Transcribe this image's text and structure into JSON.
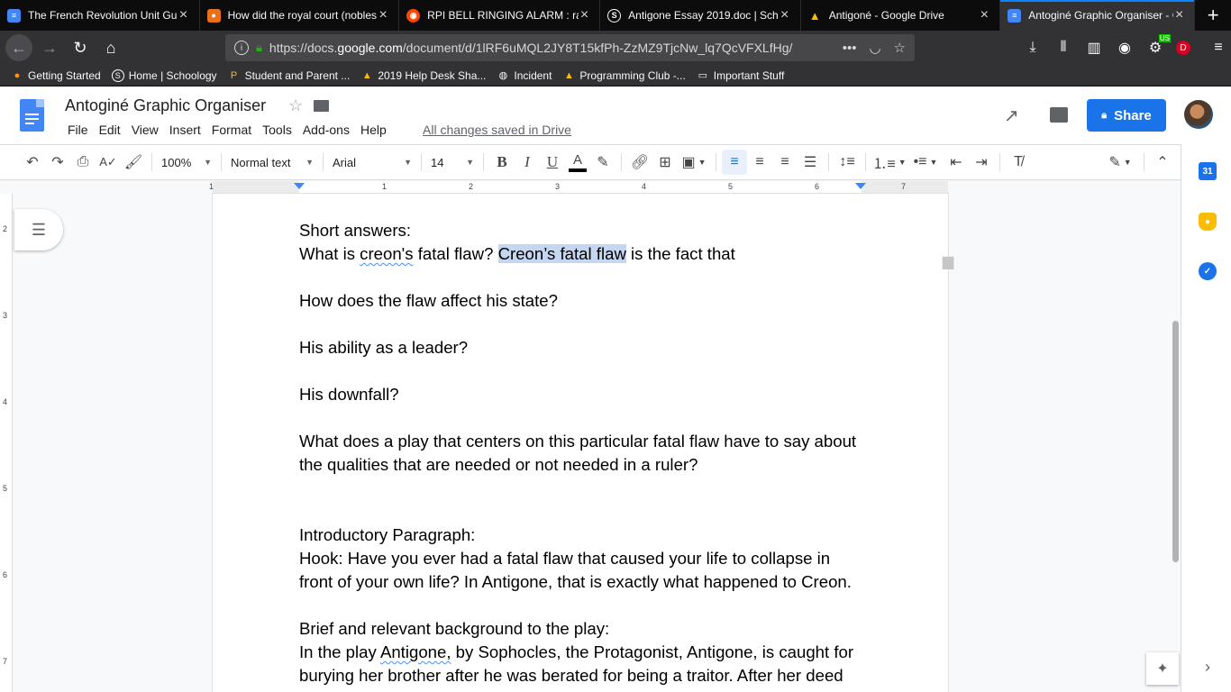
{
  "browser": {
    "tabs": [
      {
        "title": "The French Revolution Unit Gu",
        "color": "#4285f4",
        "glyph": "≡"
      },
      {
        "title": "How did the royal court (nobles",
        "color": "#e8711a",
        "glyph": "●"
      },
      {
        "title": "RPI BELL RINGING ALARM : ras",
        "color": "#ff4500",
        "glyph": "◉"
      },
      {
        "title": "Antigone Essay 2019.doc | Sch",
        "color": "#3b6ea8",
        "glyph": "S"
      },
      {
        "title": "Antigoné - Google Drive",
        "color": "#0f9d58",
        "glyph": "▲"
      },
      {
        "title": "Antoginé Graphic Organiser - G",
        "color": "#4285f4",
        "glyph": "≡"
      }
    ],
    "url_prefix": "https://docs.",
    "url_domain": "google.com",
    "url_rest": "/document/d/1lRF6uMQL2JY8T15kfPh-ZzMZ9TjcNw_lq7QcVFXLfHg/",
    "bookmarks": [
      {
        "label": "Getting Started",
        "icon": "firefox-icon"
      },
      {
        "label": "Home | Schoology",
        "icon": "schoology-icon"
      },
      {
        "label": "Student and Parent ...",
        "icon": "parent-portal-icon"
      },
      {
        "label": "2019 Help Desk Sha...",
        "icon": "drive-icon"
      },
      {
        "label": "Incident",
        "icon": "globe-icon"
      },
      {
        "label": "Programming Club -...",
        "icon": "drive-icon"
      },
      {
        "label": "Important Stuff",
        "icon": "folder-icon"
      }
    ],
    "badge_us": "US",
    "avatar_letter": "D"
  },
  "doc": {
    "title": "Antoginé Graphic Organiser",
    "menu": [
      "File",
      "Edit",
      "View",
      "Insert",
      "Format",
      "Tools",
      "Add-ons",
      "Help"
    ],
    "saved_status": "All changes saved in Drive",
    "share_label": "Share"
  },
  "toolbar": {
    "zoom": "100%",
    "style": "Normal text",
    "font": "Arial",
    "size": "14"
  },
  "rulers": {
    "horizontal": [
      "1",
      "1",
      "2",
      "3",
      "4",
      "5",
      "6",
      "7"
    ],
    "vertical": [
      "2",
      "3",
      "4",
      "5",
      "6",
      "7"
    ]
  },
  "content": {
    "short_answers": "Short answers:",
    "q1_a": "What is ",
    "q1_b": "creon's",
    "q1_c": " fatal flaw? ",
    "q1_sel": "Creon’s fatal flaw",
    "q1_d": " is the fact that",
    "q2": "How does the flaw affect his state?",
    "q3": "His ability as a leader?",
    "q4": "His downfall?",
    "q5": "What does a play that centers on this particular fatal flaw have to say about the qualities that are needed or not needed in a ruler?",
    "intro": "Introductory Paragraph:",
    "hook": "Hook: Have you ever had a fatal flaw that caused your life to collapse in front of your own life? In Antigone, that is exactly what happened to Creon.",
    "bg": "Brief and relevant background to the play:",
    "bg_text_a": "In the play ",
    "bg_text_b": "Antigone,",
    "bg_text_c": " by Sophocles, the Protagonist, Antigone, is caught for burying her brother after he was berated for being a traitor. After her deed"
  },
  "colors": {
    "accent": "#1a73e8",
    "selection": "#c5d6f1",
    "tab_active_indicator": "#0a84ff"
  }
}
